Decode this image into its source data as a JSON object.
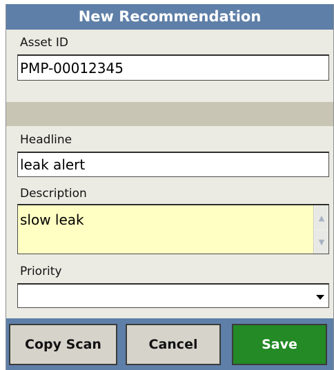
{
  "window": {
    "title": "New Recommendation"
  },
  "asset": {
    "label": "Asset ID",
    "value": "PMP-00012345"
  },
  "headline": {
    "label": "Headline",
    "value": "leak alert"
  },
  "description": {
    "label": "Description",
    "value": "slow leak",
    "scroll_up_icon": "chevron-up-icon",
    "scroll_down_icon": "chevron-down-icon"
  },
  "priority": {
    "label": "Priority",
    "value": ""
  },
  "buttons": {
    "copy_scan": "Copy Scan",
    "cancel": "Cancel",
    "save": "Save"
  },
  "colors": {
    "titlebar": "#5e7fa8",
    "form_background": "#ecebe3",
    "separator": "#c9c5b4",
    "description_background": "#ffffc3",
    "save_button": "#238a25",
    "gray_button": "#d6d3ca"
  }
}
